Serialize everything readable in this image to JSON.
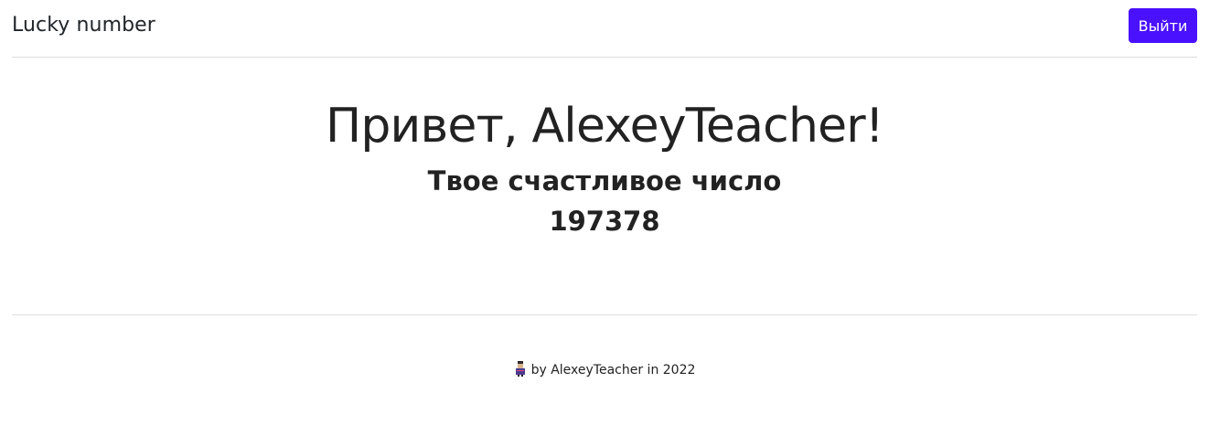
{
  "header": {
    "brand": "Lucky number",
    "logout_label": "Выйти"
  },
  "main": {
    "greeting": "Привет, AlexeyTeacher!",
    "subtitle": "Твое счастливое число",
    "lucky_number": "197378"
  },
  "footer": {
    "text": "by AlexeyTeacher in 2022",
    "avatar_icon": "person-avatar-icon"
  },
  "colors": {
    "accent": "#4a11ff",
    "text": "#222222",
    "divider": "#dedede"
  }
}
